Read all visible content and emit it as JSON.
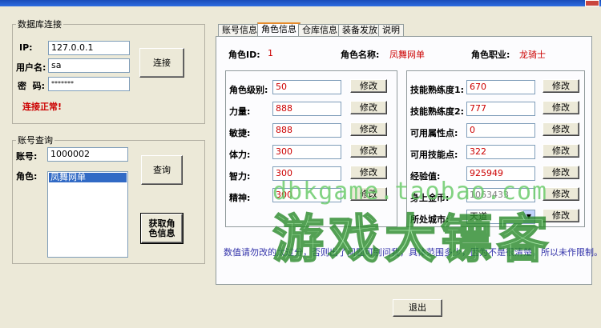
{
  "db": {
    "legend": "数据库连接",
    "ip_label": "IP:",
    "ip_value": "127.0.0.1",
    "user_label": "用户名:",
    "user_value": "sa",
    "pwd_label": "密  码:",
    "pwd_value": "*******",
    "connect_button": "连接",
    "status": "连接正常!"
  },
  "account": {
    "legend": "账号查询",
    "account_label": "账号:",
    "account_value": "1000002",
    "role_label": "角色:",
    "roles": [
      "凤舞网单"
    ],
    "query_button": "查询",
    "get_role_button": "获取角色信息"
  },
  "tabs": [
    "账号信息",
    "角色信息",
    "仓库信息",
    "装备发放",
    "说明"
  ],
  "active_tab": "角色信息",
  "role_info": {
    "id_label": "角色ID:",
    "id_value": "1",
    "name_label": "角色名称:",
    "name_value": "凤舞网单",
    "class_label": "角色职业:",
    "class_value": "龙骑士"
  },
  "left_stats": [
    {
      "label": "角色级别:",
      "value": "50"
    },
    {
      "label": "力量:",
      "value": "888"
    },
    {
      "label": "敏捷:",
      "value": "888"
    },
    {
      "label": "体力:",
      "value": "300"
    },
    {
      "label": "智力:",
      "value": "300"
    },
    {
      "label": "精神:",
      "value": "300"
    }
  ],
  "right_stats": [
    {
      "label": "技能熟练度1:",
      "value": "670"
    },
    {
      "label": "技能熟练度2:",
      "value": "777"
    },
    {
      "label": "可用属性点:",
      "value": "0"
    },
    {
      "label": "可用技能点:",
      "value": "322"
    },
    {
      "label": "经验值:",
      "value": "925949"
    },
    {
      "label": "身上金币:",
      "value": "1063433"
    },
    {
      "label": "所处城市:",
      "value": "天道"
    }
  ],
  "modify_label": "修改",
  "hint": "数值请勿改的太过分，否则出了问题可别问我，具体范围多少，因为不是很清楚，所以未作限制。",
  "exit_button": "退出",
  "watermark": {
    "url": "dbkgame.taobao.com",
    "name": "游戏大镖客"
  }
}
